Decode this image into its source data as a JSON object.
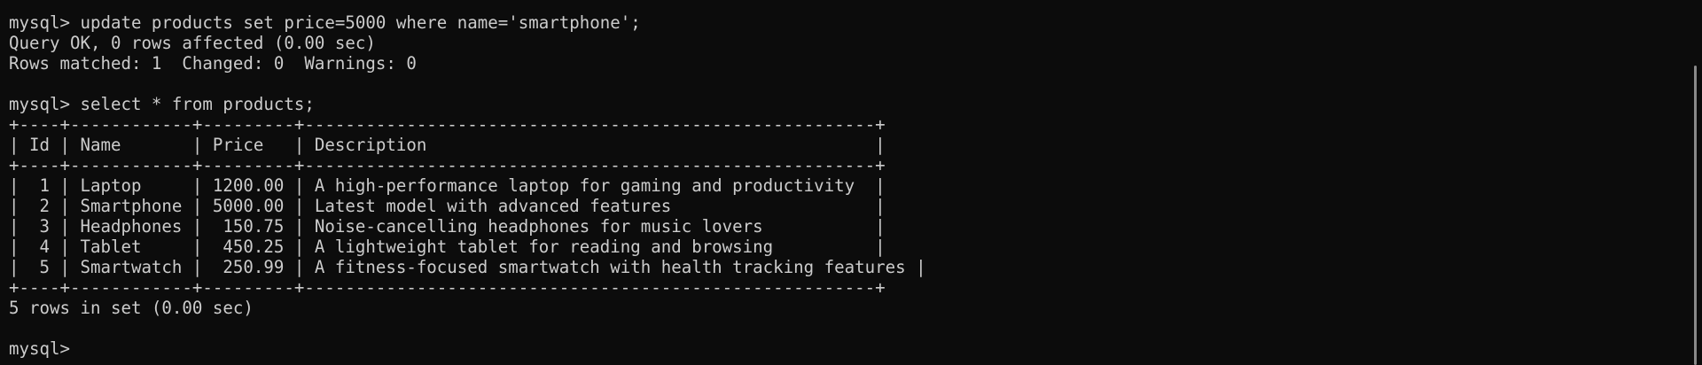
{
  "terminal": {
    "lines": [
      "mysql> update products set price=5000 where name='smartphone';",
      "Query OK, 0 rows affected (0.00 sec)",
      "Rows matched: 1  Changed: 0  Warnings: 0",
      "",
      "mysql> select * from products;",
      "+----+------------+---------+--------------------------------------------------------+",
      "| Id | Name       | Price   | Description                                            |",
      "+----+------------+---------+--------------------------------------------------------+",
      "|  1 | Laptop     | 1200.00 | A high-performance laptop for gaming and productivity  |",
      "|  2 | Smartphone | 5000.00 | Latest model with advanced features                    |",
      "|  3 | Headphones |  150.75 | Noise-cancelling headphones for music lovers           |",
      "|  4 | Tablet     |  450.25 | A lightweight tablet for reading and browsing          |",
      "|  5 | Smartwatch |  250.99 | A fitness-focused smartwatch with health tracking features |",
      "+----+------------+---------+--------------------------------------------------------+",
      "5 rows in set (0.00 sec)",
      "",
      "mysql> "
    ]
  }
}
